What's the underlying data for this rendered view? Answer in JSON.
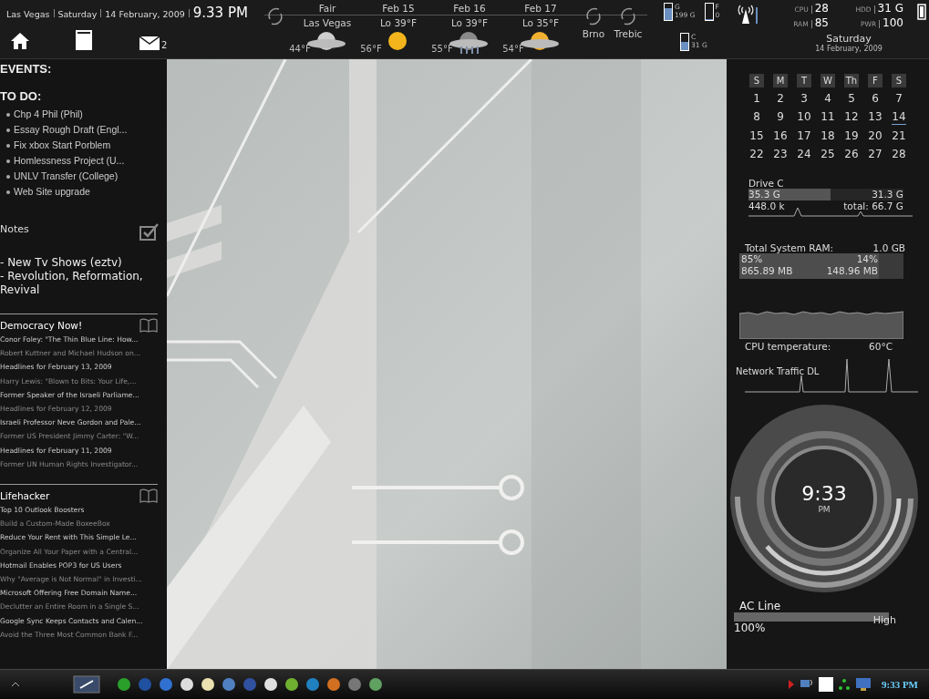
{
  "top_bar": {
    "location": "Las Vegas",
    "day": "Saturday",
    "date": "14 February, 2009",
    "time": "9.33 PM",
    "mail_count": "2"
  },
  "weather": [
    {
      "kind": "moon-cloud",
      "label": "Fair",
      "sub": "Las Vegas",
      "temp": "44°F"
    },
    {
      "kind": "sun",
      "label": "Feb 15",
      "sub": "Lo 39°F",
      "temp": "56°F"
    },
    {
      "kind": "rain",
      "label": "Feb 16",
      "sub": "Lo 39°F",
      "temp": "55°F"
    },
    {
      "kind": "sun-cloud",
      "label": "Feb 17",
      "sub": "Lo 35°F",
      "temp": "54°F"
    }
  ],
  "cities": [
    "Brno",
    "Trebic"
  ],
  "drives": [
    {
      "letter": "G",
      "size": "199 G",
      "level": 0.7
    },
    {
      "letter": "F",
      "size": "0",
      "level": 0.05
    },
    {
      "letter": "C",
      "size": "31 G",
      "level": 0.5
    }
  ],
  "stats": [
    {
      "label": "CPU",
      "value": "28"
    },
    {
      "label": "HDD",
      "value": "31 G"
    },
    {
      "label": "RAM",
      "value": "85"
    },
    {
      "label": "PWR",
      "value": "100"
    }
  ],
  "date_widget": {
    "day": "Saturday",
    "date": "14 February, 2009"
  },
  "events": {
    "title": "EVENTS:"
  },
  "todo": {
    "title": "TO DO:",
    "items": [
      "Chp 4 Phil (Phil)",
      "Essay Rough Draft (Engl...",
      "Fix xbox Start Porblem",
      "Homlessness Project (U...",
      "UNLV Transfer (College)",
      "Web Site upgrade"
    ]
  },
  "notes": {
    "title": "Notes",
    "items": [
      "- New Tv Shows (eztv)",
      "- Revolution, Reformation, Revival"
    ]
  },
  "feeds": [
    {
      "title": "Democracy Now!",
      "items": [
        "Conor Foley: \"The Thin Blue Line: How...",
        "Robert Kuttner and Michael Hudson on...",
        "Headlines for February 13, 2009",
        "Harry Lewis: \"Blown to Bits: Your Life,...",
        "Former Speaker of the Israeli Parliame...",
        "Headlines for February 12, 2009",
        "Israeli Professor Neve Gordon and Pale...",
        "Former US President Jimmy Carter: \"W...",
        "Headlines for February 11, 2009",
        "Former UN Human Rights Investigator..."
      ]
    },
    {
      "title": "Lifehacker",
      "items": [
        "Top 10 Outlook Boosters",
        "Build a Custom-Made BoxeeBox",
        "Reduce Your Rent with This Simple Le...",
        "Organize All Your Paper with a Central...",
        "Hotmail Enables POP3 for US Users",
        "Why \"Average is Not Normal\" in Investi...",
        "Microsoft Offering Free Domain Name...",
        "Declutter an Entire Room in a Single S...",
        "Google Sync Keeps Contacts and Calen...",
        "Avoid the Three Most Common Bank F..."
      ]
    }
  ],
  "calendar": {
    "weekdays": [
      "S",
      "M",
      "T",
      "W",
      "Th",
      "F",
      "S"
    ],
    "weeks": [
      [
        {
          "day": "1",
          "selected": false
        },
        {
          "day": "2",
          "selected": false
        },
        {
          "day": "3",
          "selected": false
        },
        {
          "day": "4",
          "selected": false
        },
        {
          "day": "5",
          "selected": false
        },
        {
          "day": "6",
          "selected": false
        },
        {
          "day": "7",
          "selected": false
        }
      ],
      [
        {
          "day": "8",
          "selected": false
        },
        {
          "day": "9",
          "selected": false
        },
        {
          "day": "10",
          "selected": false
        },
        {
          "day": "11",
          "selected": false
        },
        {
          "day": "12",
          "selected": false
        },
        {
          "day": "13",
          "selected": false
        },
        {
          "day": "14",
          "selected": true
        }
      ],
      [
        {
          "day": "15",
          "selected": false
        },
        {
          "day": "16",
          "selected": false
        },
        {
          "day": "17",
          "selected": false
        },
        {
          "day": "18",
          "selected": false
        },
        {
          "day": "19",
          "selected": false
        },
        {
          "day": "20",
          "selected": false
        },
        {
          "day": "21",
          "selected": false
        }
      ],
      [
        {
          "day": "22",
          "selected": false
        },
        {
          "day": "23",
          "selected": false
        },
        {
          "day": "24",
          "selected": false
        },
        {
          "day": "25",
          "selected": false
        },
        {
          "day": "26",
          "selected": false
        },
        {
          "day": "27",
          "selected": false
        },
        {
          "day": "28",
          "selected": false
        }
      ]
    ]
  },
  "drive_c": {
    "title": "Drive C",
    "used": "35.3 G",
    "free": "31.3 G",
    "rate": "448.0 k",
    "total": "total: 66.7 G",
    "level": 0.53
  },
  "ram": {
    "title": "Total System RAM:",
    "total": "1.0 GB",
    "used_pct": "85%",
    "free_pct": "14%",
    "used": "865.89 MB",
    "free": "148.96 MB",
    "level": 0.85
  },
  "cpu": {
    "label": "CPU temperature:",
    "value": "60°C"
  },
  "network": {
    "label": "Network Traffic DL"
  },
  "clock": {
    "time": "9:33",
    "ampm": "PM"
  },
  "power": {
    "label": "AC Line",
    "mode": "High",
    "percent": "100%",
    "level": 1
  },
  "taskbar": {
    "time": "9:33 PM"
  }
}
